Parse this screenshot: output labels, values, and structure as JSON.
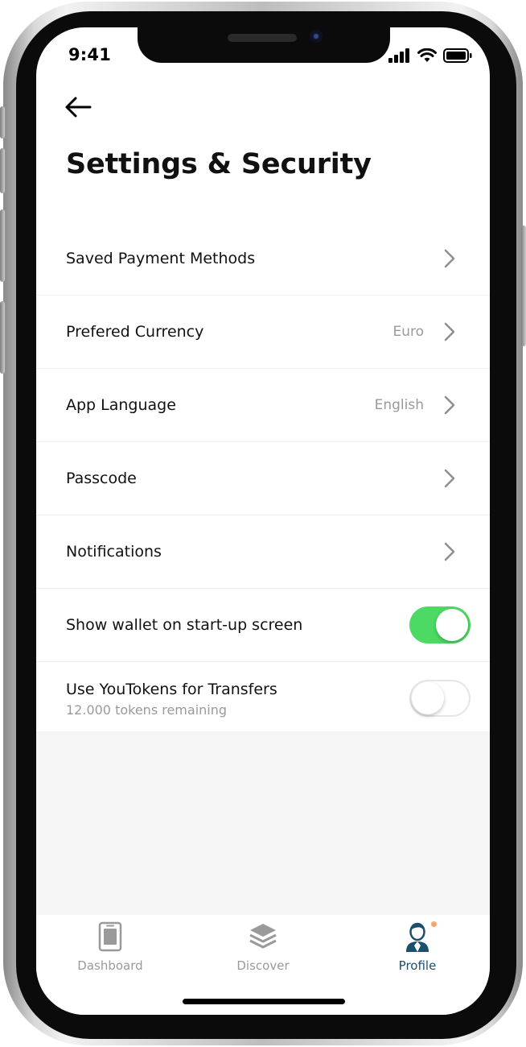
{
  "status_bar": {
    "time": "9:41"
  },
  "header": {
    "title": "Settings & Security"
  },
  "settings": {
    "items": [
      {
        "label": "Saved Payment Methods",
        "value": ""
      },
      {
        "label": "Prefered Currency",
        "value": "Euro"
      },
      {
        "label": "App Language",
        "value": "English"
      },
      {
        "label": "Passcode",
        "value": ""
      },
      {
        "label": "Notifications",
        "value": ""
      }
    ],
    "toggles": [
      {
        "label": "Show wallet on start-up screen",
        "sub": "",
        "on": true
      },
      {
        "label": "Use YouTokens for Transfers",
        "sub": "12.000 tokens remaining",
        "on": false
      }
    ]
  },
  "tab_bar": {
    "tabs": [
      {
        "label": "Dashboard",
        "icon": "dashboard-icon",
        "active": false
      },
      {
        "label": "Discover",
        "icon": "layers-icon",
        "active": false
      },
      {
        "label": "Profile",
        "icon": "profile-icon",
        "active": true
      }
    ]
  },
  "colors": {
    "toggle_on": "#4cd964",
    "active_tab": "#1b4f6e",
    "notification_dot": "#f5a66b"
  }
}
